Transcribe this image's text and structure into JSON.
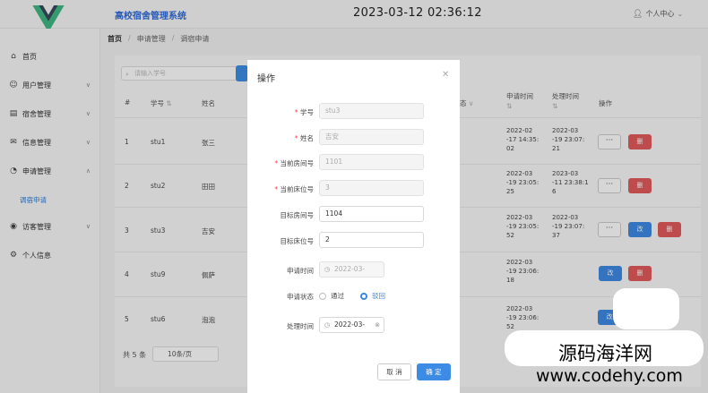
{
  "header": {
    "app_title": "高校宿舍管理系统",
    "clock": "2023-03-12 02:36:12",
    "user_label": "个人中心"
  },
  "sidebar": {
    "items": [
      {
        "label": "首页",
        "icon": "home-icon"
      },
      {
        "label": "用户管理",
        "icon": "user-icon"
      },
      {
        "label": "宿舍管理",
        "icon": "dorm-icon"
      },
      {
        "label": "信息管理",
        "icon": "mail-icon"
      },
      {
        "label": "申请管理",
        "icon": "clock-icon"
      },
      {
        "label": "调宿申请",
        "icon": ""
      },
      {
        "label": "访客管理",
        "icon": "eye-icon"
      },
      {
        "label": "个人信息",
        "icon": "gear-icon"
      }
    ]
  },
  "breadcrumb": [
    "首页",
    "申请管理",
    "调宿申请"
  ],
  "search": {
    "placeholder": "请输入学号"
  },
  "table": {
    "headers": [
      "#",
      "学号",
      "姓名",
      "申请时间",
      "处理时间",
      "操作"
    ],
    "rows": [
      {
        "idx": "1",
        "sid": "stu1",
        "name": "张三",
        "apply": [
          "2022-02",
          "-17 14:35:",
          "02"
        ],
        "process": [
          "2022-03",
          "-19 23:07:",
          "21"
        ]
      },
      {
        "idx": "2",
        "sid": "stu2",
        "name": "田田",
        "apply": [
          "2022-03",
          "-19 23:05:",
          "25"
        ],
        "process": [
          "2023-03",
          "-11 23:38:1",
          "6"
        ]
      },
      {
        "idx": "3",
        "sid": "stu3",
        "name": "吉安",
        "apply": [
          "2022-03",
          "-19 23:05:",
          "52"
        ],
        "process": [
          "2022-03",
          "-19 23:07:",
          "37"
        ]
      },
      {
        "idx": "4",
        "sid": "stu9",
        "name": "佩萨",
        "apply": [
          "2022-03",
          "-19 23:06:",
          "18"
        ],
        "process": [
          "",
          "",
          ""
        ]
      },
      {
        "idx": "5",
        "sid": "stu6",
        "name": "泡泡",
        "apply": [
          "2022-03",
          "-19 23:06:",
          "52"
        ],
        "process": [
          "",
          "",
          ""
        ]
      }
    ],
    "more_label": "···",
    "delete_label": "删",
    "edit_label": "改"
  },
  "pagination": {
    "total": "共 5 条",
    "page_size": "10条/页"
  },
  "dialog": {
    "title": "操作",
    "fields": [
      {
        "label": "学号",
        "value": "stu3",
        "required": true
      },
      {
        "label": "姓名",
        "value": "吉安",
        "required": true
      },
      {
        "label": "当前房间号",
        "value": "1101",
        "required": true
      },
      {
        "label": "当前床位号",
        "value": "3",
        "required": true
      },
      {
        "label": "目标房间号",
        "value": "1104",
        "required": false
      },
      {
        "label": "目标床位号",
        "value": "2",
        "required": false
      }
    ],
    "apply_time_label": "申请时间",
    "apply_time_value": "2022-03-",
    "status_label": "申请状态",
    "status_options": [
      "通过",
      "驳回"
    ],
    "status_selected": "驳回",
    "process_time_label": "处理时间",
    "process_time_value": "2022-03-",
    "cancel_label": "取 消",
    "confirm_label": "确 定"
  },
  "watermark": {
    "line1": "源码海洋网",
    "line2": "www.codehy.com"
  },
  "colors": {
    "primary": "#3c8ce5",
    "danger": "#e45b5b",
    "title": "#2f6bd8"
  }
}
